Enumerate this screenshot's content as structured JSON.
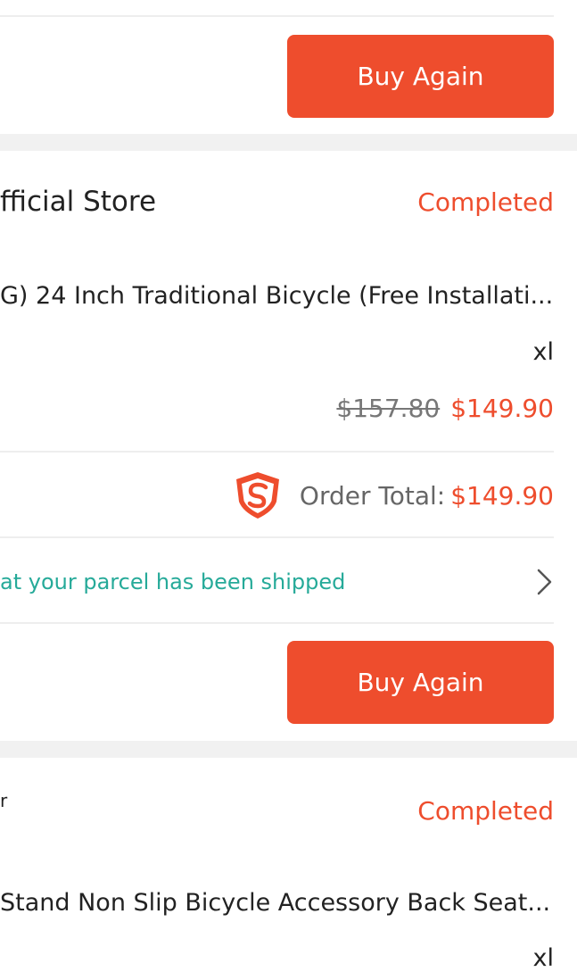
{
  "order1": {
    "buy_again_label": "Buy Again"
  },
  "order2": {
    "store_name": "fficial Store",
    "status": "Completed",
    "product_name": "G) 24 Inch Traditional Bicycle (Free Installati...",
    "variation": "xl",
    "original_price": "$157.80",
    "price": "$149.90",
    "order_total_label": "Order Total:",
    "order_total_value": "$149.90",
    "shipping_text": "at your parcel has been shipped",
    "buy_again_label": "Buy Again"
  },
  "order3": {
    "store_name": "r",
    "status": "Completed",
    "product_name": "Stand Non Slip Bicycle Accessory Back Seat...",
    "variation": "xl"
  },
  "colors": {
    "accent": "#ee4d2d",
    "shipping_green": "#26aa99",
    "gap_grey": "#f1f1f1"
  }
}
